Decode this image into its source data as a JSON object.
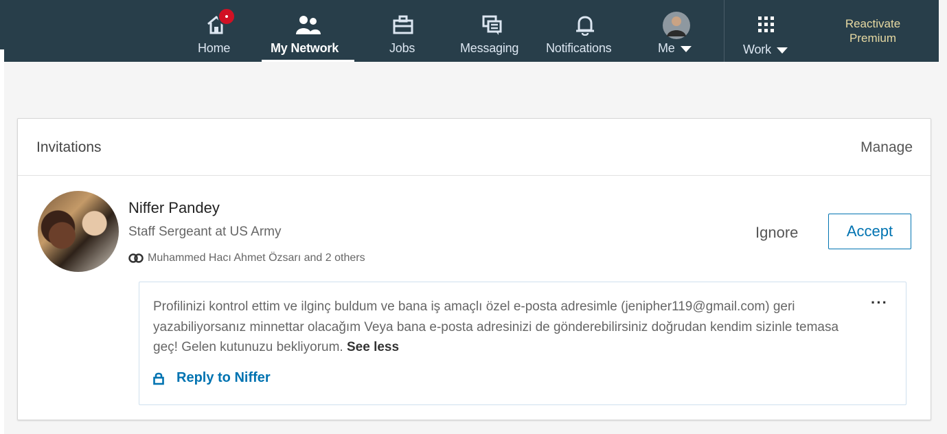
{
  "nav": {
    "items": [
      {
        "id": "home",
        "label": "Home",
        "icon": "home-icon",
        "badge": true
      },
      {
        "id": "network",
        "label": "My Network",
        "icon": "people-icon",
        "active": true
      },
      {
        "id": "jobs",
        "label": "Jobs",
        "icon": "briefcase-icon"
      },
      {
        "id": "messaging",
        "label": "Messaging",
        "icon": "chat-icon"
      },
      {
        "id": "notifications",
        "label": "Notifications",
        "icon": "bell-icon"
      },
      {
        "id": "me",
        "label": "Me",
        "icon": "avatar"
      },
      {
        "id": "work",
        "label": "Work",
        "icon": "grid-icon"
      }
    ],
    "premium_line1": "Reactivate",
    "premium_line2": "Premium"
  },
  "invitations": {
    "title": "Invitations",
    "manage_label": "Manage",
    "invite": {
      "name": "Niffer Pandey",
      "headline": "Staff Sergeant at US Army",
      "mutual": "Muhammed Hacı Ahmet Özsarı and 2 others",
      "ignore_label": "Ignore",
      "accept_label": "Accept",
      "message": "Profilinizi kontrol ettim ve ilginç buldum ve bana iş amaçlı özel e-posta adresimle (jenipher119@gmail.com) geri yazabiliyorsanız minnettar olacağım Veya bana e-posta adresinizi de gönderebilirsiniz doğrudan kendim sizinle temasa geç! Gelen kutunuzu bekliyorum.",
      "see_less_label": "See less",
      "more_label": "···",
      "reply_label": "Reply to Niffer"
    }
  },
  "colors": {
    "nav_bg": "#283e4a",
    "accent": "#0073b1",
    "badge": "#d11124",
    "premium": "#e7d9a2"
  }
}
